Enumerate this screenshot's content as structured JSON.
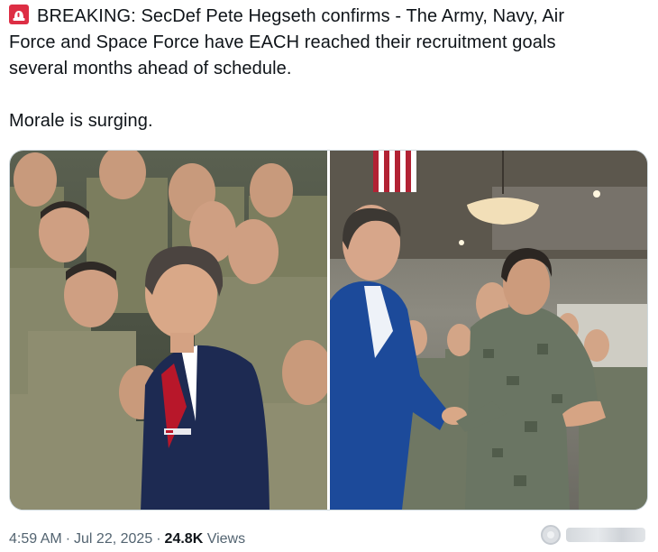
{
  "tweet": {
    "line1": "BREAKING: SecDef Pete Hegseth confirms - The Army, Navy, Air",
    "line2": "Force and Space Force have EACH reached their recruitment goals",
    "line3": "several months ahead of schedule.",
    "line4": "Morale is surging.",
    "emoji_icon": "siren-icon"
  },
  "media": {
    "photo_count": 2,
    "photo_1_content": "hegseth-with-army-soldiers",
    "photo_2_content": "hegseth-handshake-with-navy-sailor"
  },
  "meta": {
    "time": "4:59 AM",
    "separator": "·",
    "date": "Jul 22, 2025",
    "views_count": "24.8K",
    "views_label": "Views"
  },
  "colors": {
    "text": "#0f1419",
    "secondary": "#536471",
    "border": "#cfd9de",
    "siren": "#e0245e"
  }
}
